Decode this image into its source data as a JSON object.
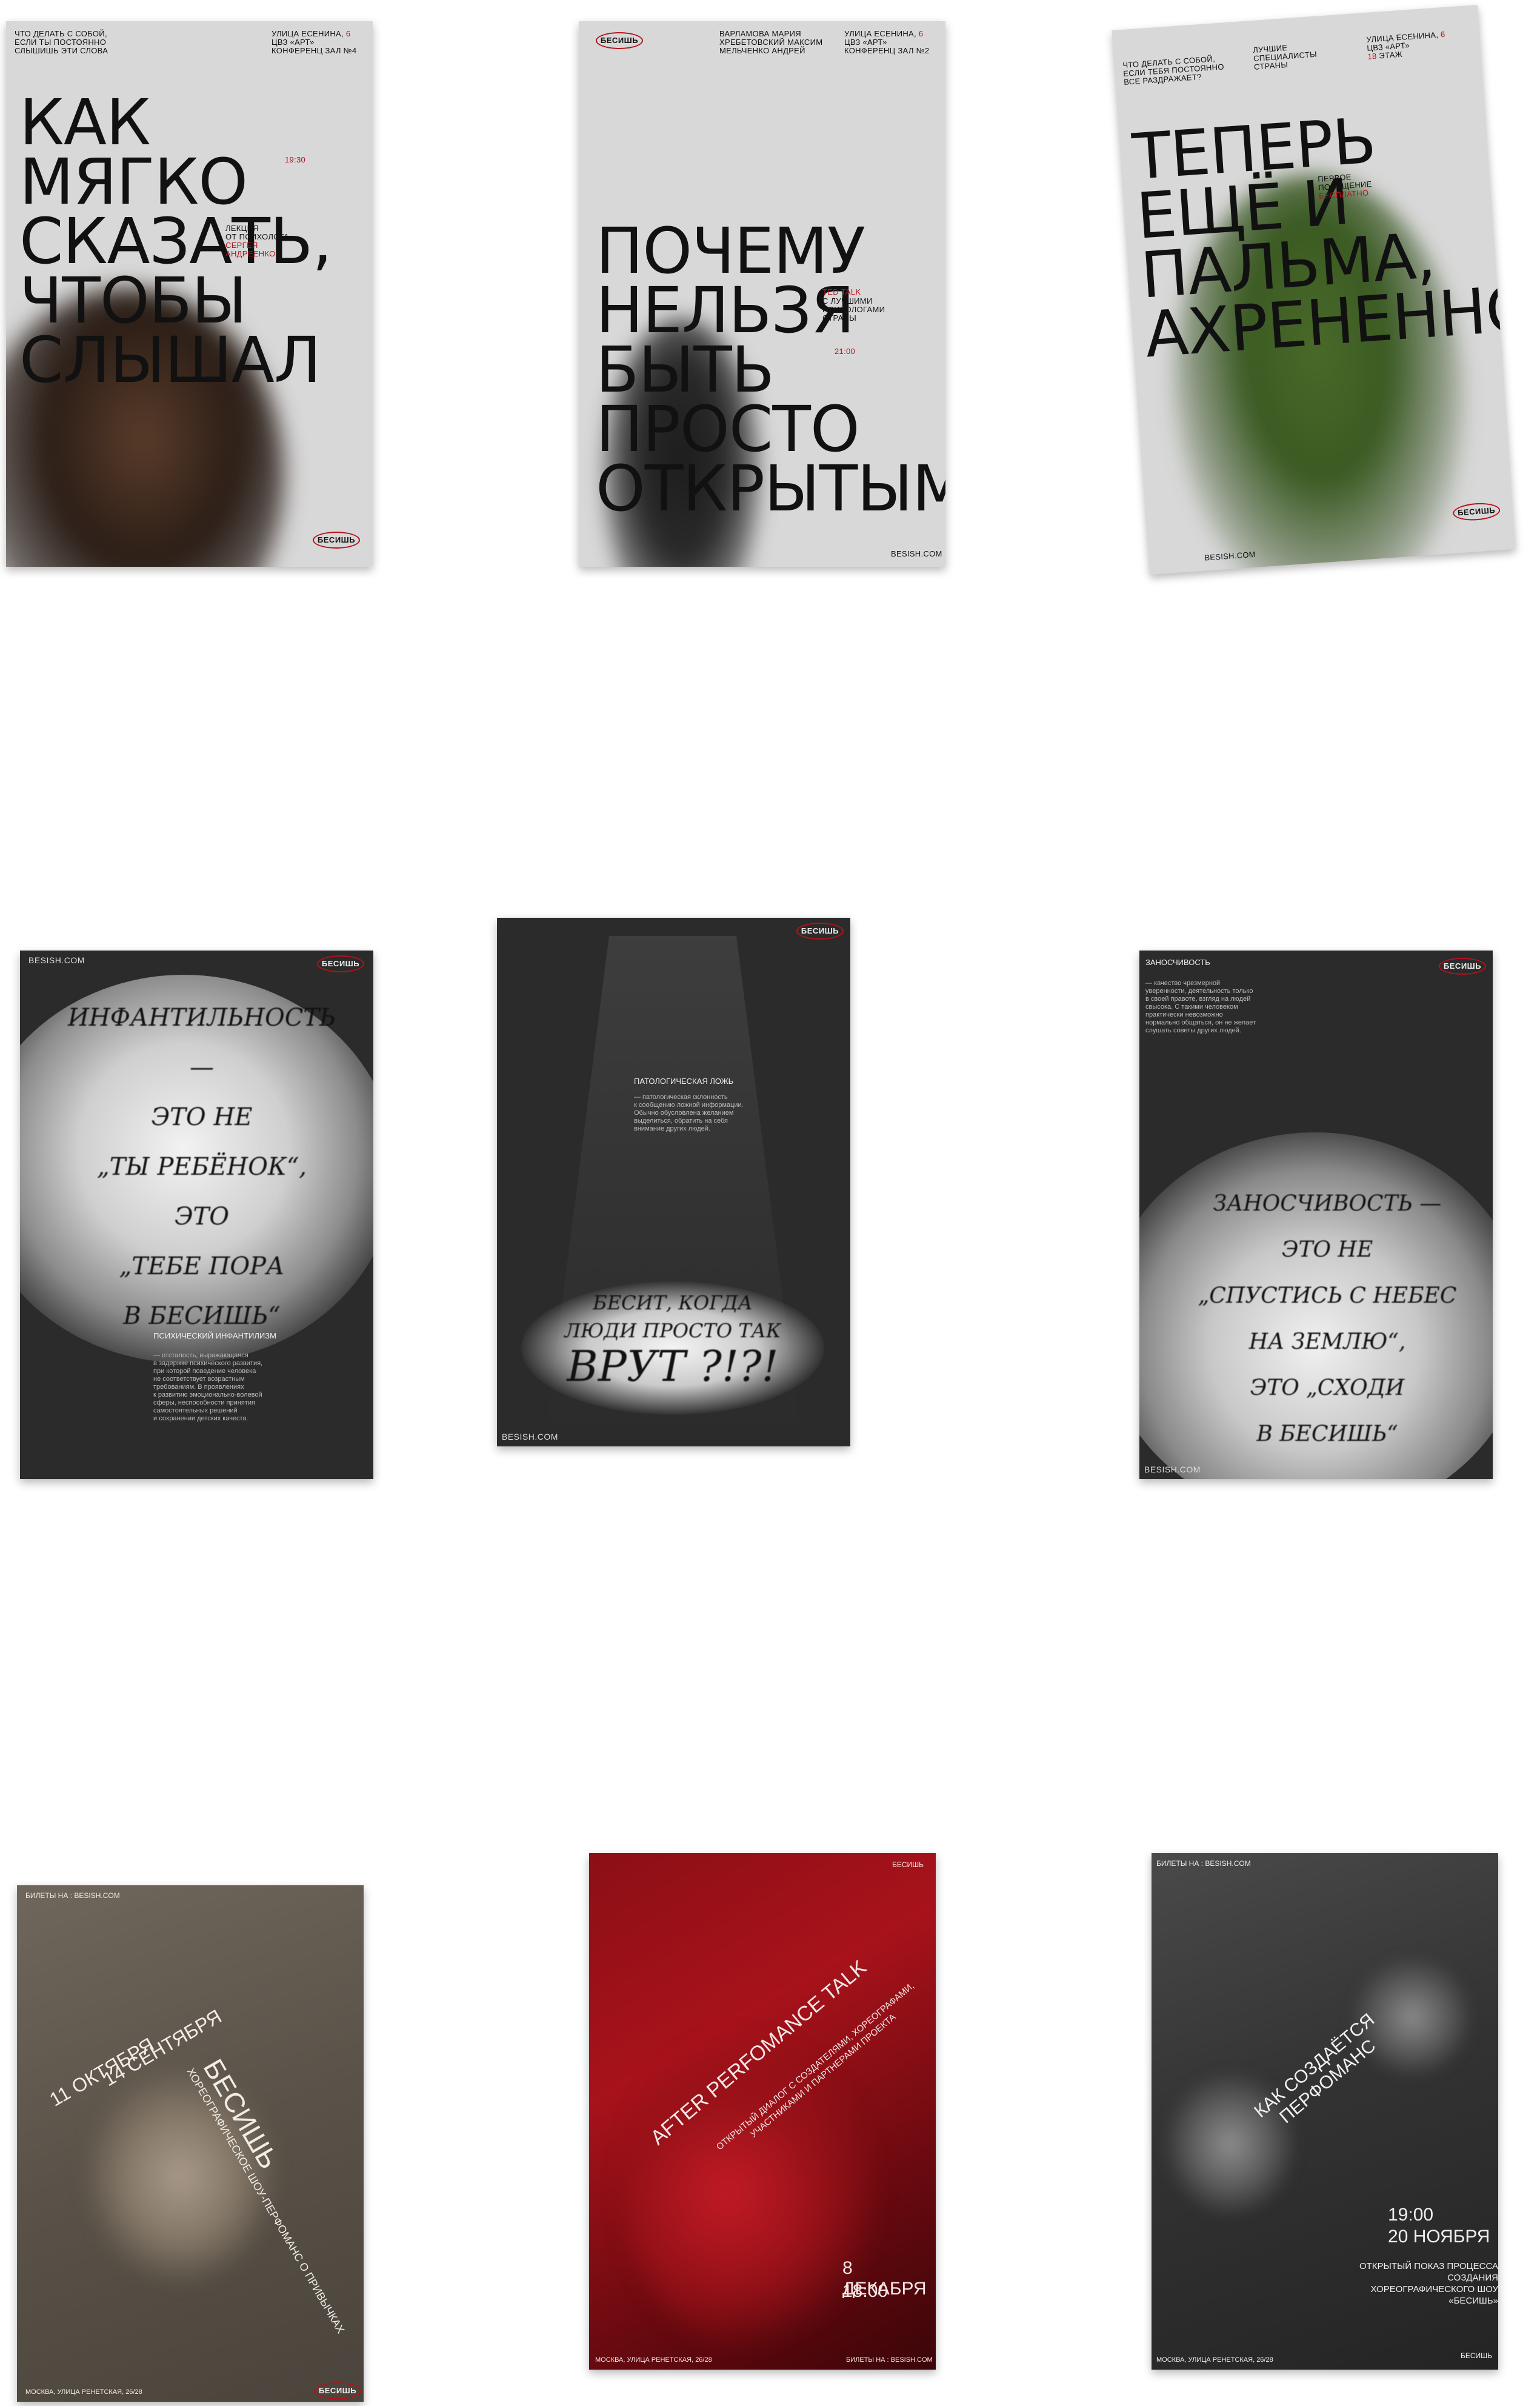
{
  "posters": {
    "p1": {
      "question": "ЧТО ДЕЛАТЬ С СОБОЙ,\nЕСЛИ ТЫ ПОСТОЯННО\nСЛЫШИШЬ ЭТИ СЛОВА",
      "address": "УЛИЦА ЕСЕНИНА,",
      "address_num": "6",
      "address2": "ЦВЗ «АРТ»\nКОНФЕРЕНЦ ЗАЛ №4",
      "headline": "КАК МЯГКО\nСКАЗАТЬ,\nЧТОБЫ\nСЛЫШАЛ",
      "time": "19:30",
      "lecture": "ЛЕКЦИЯ\nОТ ПСИХОЛОГА",
      "speaker": "СЕРГЕЯ\nАНДРЕЕНКО",
      "logo": "БЕСИШЬ"
    },
    "p2": {
      "logo": "БЕСИШЬ",
      "speakers": "ВАРЛАМОВА МАРИЯ\nХРЕБЕТОВСКИЙ МАКСИМ\nМЕЛЬЧЕНКО АНДРЕЙ",
      "address": "УЛИЦА ЕСЕНИНА,",
      "address_num": "6",
      "address2": "ЦВЗ «АРТ»\nКОНФЕРЕНЦ ЗАЛ №2",
      "headline": "ПОЧЕМУ\nНЕЛЬЗЯ\nБЫТЬ\nПРОСТО\nОТКРЫТЫМ",
      "ted": "TED TALK",
      "ted_desc": "С ЛУЧШИМИ\nПСИХОЛОГАМИ\nСТРАНЫ",
      "time": "21:00",
      "site": "BESISH.COM"
    },
    "p3": {
      "question": "ЧТО ДЕЛАТЬ С СОБОЙ,\nЕСЛИ ТЕБЯ ПОСТОЯННО\nВСЕ РАЗДРАЖАЕТ?",
      "specialists": "ЛУЧШИЕ\nСПЕЦИАЛИСТЫ\nСТРАНЫ",
      "address": "УЛИЦА ЕСЕНИНА,",
      "address_num": "6",
      "address2": "ЦВЗ «АРТ»",
      "floor_num": "18",
      "floor": "ЭТАЖ",
      "headline": "ТЕПЕРЬ\nЕЩЁ И\nПАЛЬМА,\nАХРЕНЕННО",
      "first": "ПЕРВОЕ\nПОСЕЩЕНИЕ",
      "free": "БЕСПЛАТНО",
      "logo": "БЕСИШЬ",
      "site": "BESISH.COM"
    },
    "p4": {
      "site": "BESISH.COM",
      "logo": "БЕСИШЬ",
      "hand": "ИНФАНТИЛЬНОСТЬ —\nЭТО НЕ\n„ТЫ РЕБЁНОК“,\nЭТО\n„ТЕБЕ ПОРА\nВ БЕСИШЬ“",
      "term": "ПСИХИЧЕСКИЙ ИНФАНТИЛИЗМ",
      "definition": "— отсталость, выражающаяся\nв задержке психического развития,\nпри которой поведение человека\nне соответствует возрастным\nтребованиям. В проявлениях\nк развитию эмоционально-волевой\nсферы, неспособности принятия\nсамостоятельных решений\nи сохранении детских качеств."
    },
    "p5": {
      "logo": "БЕСИШЬ",
      "term": "ПАТОЛОГИЧЕСКАЯ ЛОЖЬ",
      "definition": "— патологическая склонность\nк сообщению ложной информации.\nОбычно обусловлена желанием\nвыделиться, обратить на себя\nвнимание других людей.",
      "hand_top": "БЕСИТ, КОГДА\nЛЮДИ ПРОСТО ТАК",
      "hand_big": "ВРУТ ?!?!",
      "site": "BESISH.COM"
    },
    "p6": {
      "term": "ЗАНОСЧИВОСТЬ",
      "logo": "БЕСИШЬ",
      "definition": "— качество чрезмерной\nуверенности, деятельность только\nв своей правоте, взгляд на людей\nсвысока. С такими человеком\nпрактически невозможно\nнормально общаться, он не желает\nслушать советы других людей.",
      "hand": "ЗАНОСЧИВОСТЬ —\nЭТО НЕ\n„СПУСТИСЬ С НЕБЕС\nНА ЗЕМЛЮ“,\nЭТО „СХОДИ\nВ БЕСИШЬ“",
      "site": "BESISH.COM"
    },
    "p7": {
      "tickets": "БИЛЕТЫ НА : BESISH.COM",
      "date1": "14 СЕНТЯБРЯ",
      "date2": "11 ОКТЯБРЯ",
      "title": "БЕСИШЬ",
      "subtitle": "ХОРЕОГРАФИЧЕСКОЕ ШОУ-ПЕРФОМАНС О ПРИВЫЧКАХ",
      "address": "МОСКВА, УЛИЦА РЕНЕТСКАЯ, 26/28",
      "logo": "БЕСИШЬ"
    },
    "p8": {
      "logo": "БЕСИШЬ",
      "title": "AFTER PERFOMANCE TALK",
      "subtitle": "ОТКРЫТЫЙ ДИАЛОГ С СОЗДАТЕЛЯМИ, ХОРЕОГРАФАМИ,\nУЧАСТНИКАМИ И ПАРТНЕРАМИ ПРОЕКТА",
      "date": "8 ДЕКАБРЯ",
      "time": "18:00",
      "address": "МОСКВА, УЛИЦА РЕНЕТСКАЯ, 26/28",
      "tickets": "БИЛЕТЫ НА : BESISH.COM"
    },
    "p9": {
      "tickets": "БИЛЕТЫ НА : BESISH.COM",
      "title": "КАК СОЗДАЁТСЯ ПЕРФОМАНС",
      "time": "19:00",
      "date": "20 НОЯБРЯ",
      "desc": "ОТКРЫТЫЙ ПОКАЗ ПРОЦЕССА СОЗДАНИЯ\nХОРЕОГРАФИЧЕСКОГО ШОУ «БЕСИШЬ»",
      "address": "МОСКВА, УЛИЦА РЕНЕТСКАЯ, 26/28",
      "logo": "БЕСИШЬ"
    }
  }
}
